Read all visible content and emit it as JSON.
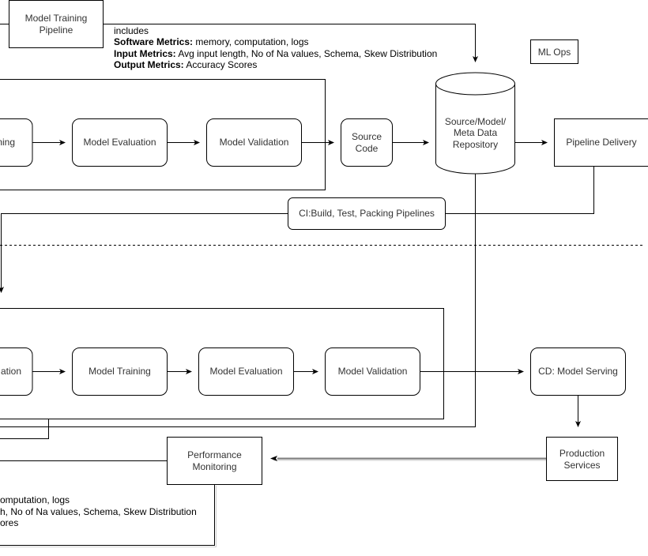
{
  "diagram": {
    "title_box": {
      "label_lines": [
        "Model Training",
        "Pipeline"
      ]
    },
    "badge": {
      "label": "ML Ops"
    },
    "top_note": {
      "intro": "includes",
      "lines": [
        {
          "key": "Software Metrics:",
          "value": " memory, computation, logs"
        },
        {
          "key": "Input Metrics:",
          "value": " Avg input length, No of Na values,  Schema, Skew Distribution"
        },
        {
          "key": "Output Metrics:",
          "value": " Accuracy Scores"
        }
      ]
    },
    "bottom_note": {
      "lines": [
        "omputation, logs",
        "h, No of Na values,  Schema, Skew Distribution",
        "ores"
      ]
    },
    "top_row": {
      "nodes": [
        {
          "label": "ning"
        },
        {
          "label": "Model Evaluation"
        },
        {
          "label": "Model Validation"
        }
      ]
    },
    "source_code": {
      "label_lines": [
        "Source",
        "Code"
      ]
    },
    "repository": {
      "label_lines": [
        "Source/Model/",
        "Meta Data",
        "Repository"
      ]
    },
    "pipeline_delivery": {
      "label": "Pipeline Delivery"
    },
    "ci_box": {
      "label": "CI:Build, Test, Packing Pipelines"
    },
    "bottom_row": {
      "nodes": [
        {
          "label": "ation"
        },
        {
          "label": "Model Training"
        },
        {
          "label": "Model Evaluation"
        },
        {
          "label": "Model Validation"
        }
      ]
    },
    "cd_box": {
      "label": "CD: Model Serving"
    },
    "production": {
      "label_lines": [
        "Production",
        "Services"
      ]
    },
    "monitoring": {
      "label_lines": [
        "Performance",
        "Monitoring"
      ]
    }
  }
}
